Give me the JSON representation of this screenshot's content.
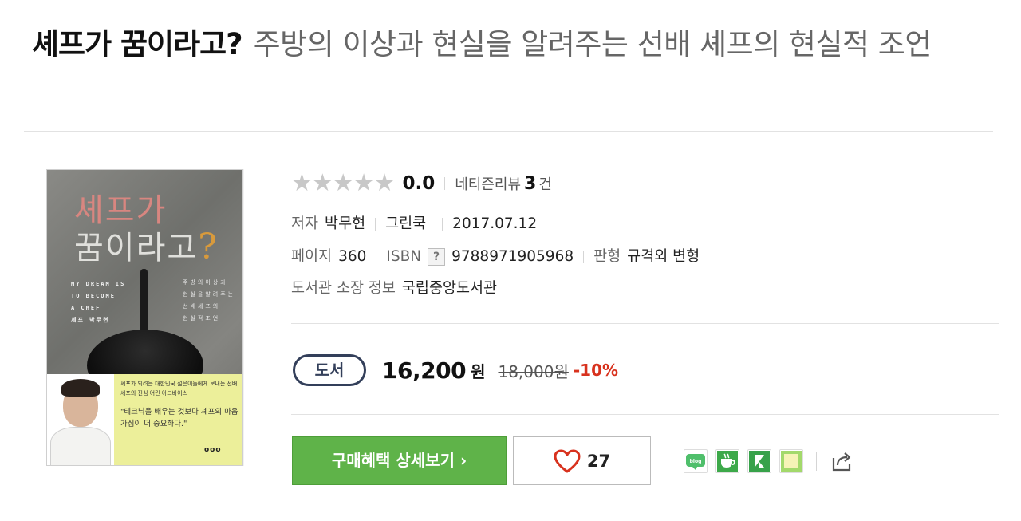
{
  "title": {
    "main": "셰프가 꿈이라고?",
    "subtitle": "주방의 이상과 현실을 알려주는 선배 셰프의 현실적 조언"
  },
  "cover": {
    "title_line1": "셰프가",
    "title_line2": "꿈이라고",
    "title_q": "?",
    "en_lines": [
      "MY DREAM IS",
      "TO BECOME",
      "A CHEF",
      "셰프  박무현"
    ],
    "kr_lines": [
      "주방의이상과",
      "현실을알려주는",
      "선배셰프의",
      "현실적조언"
    ],
    "band_text": "셰프가 되려는 대한민국 젊은이들에게 보내는 선배 셰프의 진심 어린 아드바이스",
    "band_quote": "\"테크닉을 배우는 것보다 셰프의 마음가짐이 더 중요하다.\"",
    "logo": "ooo"
  },
  "rating": {
    "stars": "★★★★★",
    "score": "0.0",
    "review_label": "네티즌리뷰",
    "review_count": "3",
    "review_unit": "건"
  },
  "meta": {
    "author_label": "저자",
    "author": "박무현",
    "publisher": "그린쿡",
    "date": "2017.07.12",
    "pages_label": "페이지",
    "pages": "360",
    "isbn_label": "ISBN",
    "isbn_help": "?",
    "isbn": "9788971905968",
    "format_label": "판형",
    "format": "규격외 변형",
    "library_label": "도서관 소장 정보",
    "library": "국립중앙도서관"
  },
  "price": {
    "badge": "도서",
    "price": "16,200",
    "unit": "원",
    "original": "18,000원",
    "discount": "-10%"
  },
  "actions": {
    "benefit_label": "구매혜택 상세보기 ›",
    "like_count": "27"
  },
  "share_icons": [
    "blog-icon",
    "cafe-icon",
    "k-icon",
    "memo-icon",
    "share-icon"
  ],
  "colors": {
    "benefit_button": "#5fb349",
    "discount": "#d8321e",
    "badge": "#333f5a",
    "heart": "#d8321e"
  }
}
